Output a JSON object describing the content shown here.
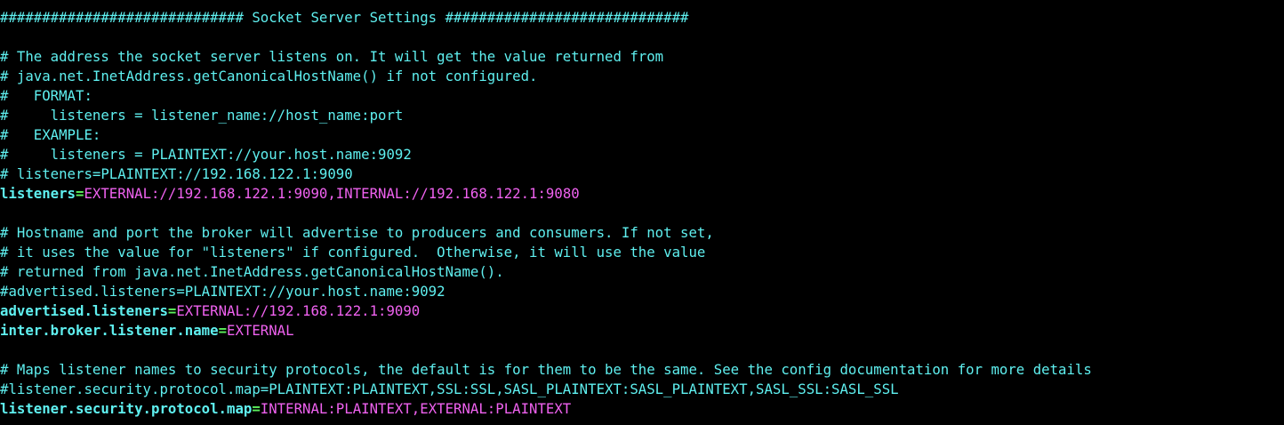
{
  "terminal": {
    "colors": {
      "background": "#000000",
      "comment": "#5ff0f0",
      "key": "#5ff0f0",
      "equals": "#5cf05c",
      "value": "#f062f0"
    },
    "lines": [
      {
        "type": "comment",
        "text": "############################# Socket Server Settings #############################"
      },
      {
        "type": "blank",
        "text": ""
      },
      {
        "type": "comment",
        "text": "# The address the socket server listens on. It will get the value returned from"
      },
      {
        "type": "comment",
        "text": "# java.net.InetAddress.getCanonicalHostName() if not configured."
      },
      {
        "type": "comment",
        "text": "#   FORMAT:"
      },
      {
        "type": "comment",
        "text": "#     listeners = listener_name://host_name:port"
      },
      {
        "type": "comment",
        "text": "#   EXAMPLE:"
      },
      {
        "type": "comment",
        "text": "#     listeners = PLAINTEXT://your.host.name:9092"
      },
      {
        "type": "comment",
        "text": "# listeners=PLAINTEXT://192.168.122.1:9090"
      },
      {
        "type": "setting",
        "key": "listeners",
        "eq": "=",
        "value": "EXTERNAL://192.168.122.1:9090,INTERNAL://192.168.122.1:9080"
      },
      {
        "type": "blank",
        "text": ""
      },
      {
        "type": "comment",
        "text": "# Hostname and port the broker will advertise to producers and consumers. If not set,"
      },
      {
        "type": "comment",
        "text": "# it uses the value for \"listeners\" if configured.  Otherwise, it will use the value"
      },
      {
        "type": "comment",
        "text": "# returned from java.net.InetAddress.getCanonicalHostName()."
      },
      {
        "type": "comment",
        "text": "#advertised.listeners=PLAINTEXT://your.host.name:9092"
      },
      {
        "type": "setting",
        "key": "advertised.listeners",
        "eq": "=",
        "value": "EXTERNAL://192.168.122.1:9090"
      },
      {
        "type": "setting",
        "key": "inter.broker.listener.name",
        "eq": "=",
        "value": "EXTERNAL"
      },
      {
        "type": "blank",
        "text": ""
      },
      {
        "type": "comment",
        "text": "# Maps listener names to security protocols, the default is for them to be the same. See the config documentation for more details"
      },
      {
        "type": "comment",
        "text": "#listener.security.protocol.map=PLAINTEXT:PLAINTEXT,SSL:SSL,SASL_PLAINTEXT:SASL_PLAINTEXT,SASL_SSL:SASL_SSL"
      },
      {
        "type": "setting",
        "key": "listener.security.protocol.map",
        "eq": "=",
        "value": "INTERNAL:PLAINTEXT,EXTERNAL:PLAINTEXT"
      }
    ]
  }
}
